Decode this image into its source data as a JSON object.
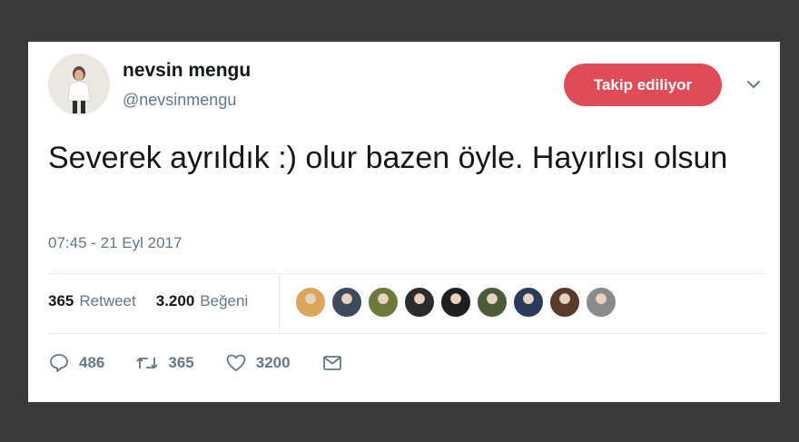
{
  "tweet": {
    "author": {
      "name": "nevsin mengu",
      "handle": "@nevsinmengu"
    },
    "follow_button_label": "Takip ediliyor",
    "text": "Severek ayrıldık :) olur bazen öyle. Hayırlısı olsun",
    "timestamp": "07:45 - 21 Eyl 2017",
    "stats": {
      "retweet_count": "365",
      "retweet_label": "Retweet",
      "like_count": "3.200",
      "like_label": "Beğeni"
    },
    "liker_avatars": [
      {
        "color": "#d9a65a"
      },
      {
        "color": "#3d4a5c"
      },
      {
        "color": "#6b7a3a"
      },
      {
        "color": "#2c2c2c"
      },
      {
        "color": "#1f1f1f"
      },
      {
        "color": "#4a5a3a"
      },
      {
        "color": "#2a3a5a"
      },
      {
        "color": "#5a3a2a"
      },
      {
        "color": "#8a8a8a"
      }
    ],
    "actions": {
      "reply_count": "486",
      "retweet_count": "365",
      "like_count": "3200"
    }
  },
  "colors": {
    "follow_button": "#df4b56",
    "secondary_text": "#657786",
    "primary_text": "#14171a"
  }
}
